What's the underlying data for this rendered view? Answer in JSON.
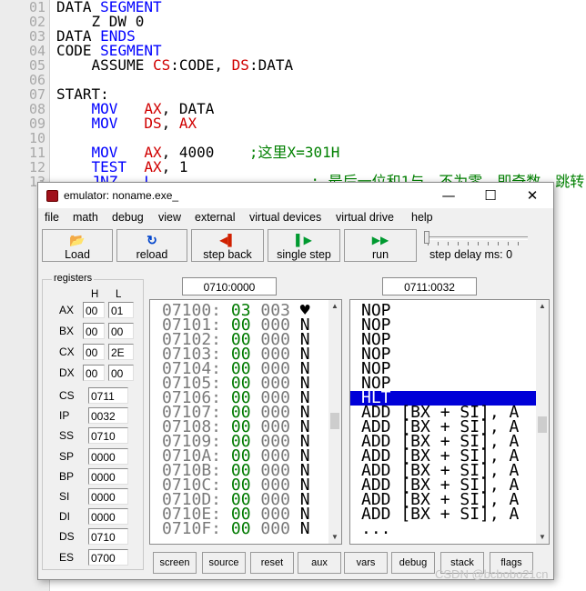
{
  "editor": {
    "line_numbers": [
      "01",
      "02",
      "03",
      "04",
      "05",
      "06",
      "07",
      "08",
      "09",
      "10",
      "11",
      "12",
      "13"
    ],
    "lines": [
      [
        {
          "t": "DATA ",
          "c": "txt"
        },
        {
          "t": "SEGMENT",
          "c": "kw"
        }
      ],
      [
        {
          "t": "    Z DW 0",
          "c": "txt"
        }
      ],
      [
        {
          "t": "DATA ",
          "c": "txt"
        },
        {
          "t": "ENDS",
          "c": "kw"
        }
      ],
      [
        {
          "t": "CODE ",
          "c": "txt"
        },
        {
          "t": "SEGMENT",
          "c": "kw"
        }
      ],
      [
        {
          "t": "    ASSUME ",
          "c": "txt"
        },
        {
          "t": "CS",
          "c": "rg"
        },
        {
          "t": ":CODE, ",
          "c": "txt"
        },
        {
          "t": "DS",
          "c": "rg"
        },
        {
          "t": ":DATA",
          "c": "txt"
        }
      ],
      [],
      [
        {
          "t": "START:",
          "c": "txt"
        }
      ],
      [
        {
          "t": "    MOV   ",
          "c": "kw"
        },
        {
          "t": "AX",
          "c": "rg"
        },
        {
          "t": ", DATA",
          "c": "txt"
        }
      ],
      [
        {
          "t": "    MOV   ",
          "c": "kw"
        },
        {
          "t": "DS",
          "c": "rg"
        },
        {
          "t": ", ",
          "c": "txt"
        },
        {
          "t": "AX",
          "c": "rg"
        }
      ],
      [],
      [
        {
          "t": "    MOV   ",
          "c": "kw"
        },
        {
          "t": "AX",
          "c": "rg"
        },
        {
          "t": ", 4000    ",
          "c": "txt"
        },
        {
          "t": ";这里X=301H",
          "c": "cm"
        }
      ],
      [
        {
          "t": "    TEST  ",
          "c": "kw"
        },
        {
          "t": "AX",
          "c": "rg"
        },
        {
          "t": ", 1",
          "c": "txt"
        }
      ],
      [
        {
          "t": "    JNZ   L                  ",
          "c": "kw"
        },
        {
          "t": "; 最后一位和1与，不为零，即奇数，跳转",
          "c": "cm"
        }
      ]
    ]
  },
  "window": {
    "title": "emulator: noname.exe_",
    "controls": {
      "minimize": "—",
      "maximize": "☐",
      "close": "✕"
    }
  },
  "menu": [
    "file",
    "math",
    "debug",
    "view",
    "external",
    "virtual devices",
    "virtual drive",
    "help"
  ],
  "toolbar": {
    "load": {
      "icon": "📂",
      "label": "Load"
    },
    "reload": {
      "icon": "↻",
      "label": "reload"
    },
    "step_back": {
      "icon": "◀▌",
      "label": "step back"
    },
    "single_step": {
      "icon": "▌▶",
      "label": "single step"
    },
    "run": {
      "icon": "▶▶",
      "label": "run"
    },
    "step_delay_label": "step delay ms: 0"
  },
  "registers": {
    "caption": "registers",
    "h_label": "H",
    "l_label": "L",
    "general": [
      {
        "name": "AX",
        "h": "00",
        "l": "01"
      },
      {
        "name": "BX",
        "h": "00",
        "l": "00"
      },
      {
        "name": "CX",
        "h": "00",
        "l": "2E"
      },
      {
        "name": "DX",
        "h": "00",
        "l": "00"
      }
    ],
    "special": [
      {
        "name": "CS",
        "value": "0711"
      },
      {
        "name": "IP",
        "value": "0032"
      },
      {
        "name": "SS",
        "value": "0710"
      },
      {
        "name": "SP",
        "value": "0000"
      },
      {
        "name": "BP",
        "value": "0000"
      },
      {
        "name": "SI",
        "value": "0000"
      },
      {
        "name": "DI",
        "value": "0000"
      },
      {
        "name": "DS",
        "value": "0710"
      },
      {
        "name": "ES",
        "value": "0700"
      }
    ]
  },
  "memory": {
    "address_field": "0710:0000",
    "rows": [
      {
        "addr": "07100:",
        "hex": "03",
        "dec": "003",
        "ch": "♥"
      },
      {
        "addr": "07101:",
        "hex": "00",
        "dec": "000",
        "ch": "N"
      },
      {
        "addr": "07102:",
        "hex": "00",
        "dec": "000",
        "ch": "N"
      },
      {
        "addr": "07103:",
        "hex": "00",
        "dec": "000",
        "ch": "N"
      },
      {
        "addr": "07104:",
        "hex": "00",
        "dec": "000",
        "ch": "N"
      },
      {
        "addr": "07105:",
        "hex": "00",
        "dec": "000",
        "ch": "N"
      },
      {
        "addr": "07106:",
        "hex": "00",
        "dec": "000",
        "ch": "N"
      },
      {
        "addr": "07107:",
        "hex": "00",
        "dec": "000",
        "ch": "N"
      },
      {
        "addr": "07108:",
        "hex": "00",
        "dec": "000",
        "ch": "N"
      },
      {
        "addr": "07109:",
        "hex": "00",
        "dec": "000",
        "ch": "N"
      },
      {
        "addr": "0710A:",
        "hex": "00",
        "dec": "000",
        "ch": "N"
      },
      {
        "addr": "0710B:",
        "hex": "00",
        "dec": "000",
        "ch": "N"
      },
      {
        "addr": "0710C:",
        "hex": "00",
        "dec": "000",
        "ch": "N"
      },
      {
        "addr": "0710D:",
        "hex": "00",
        "dec": "000",
        "ch": "N"
      },
      {
        "addr": "0710E:",
        "hex": "00",
        "dec": "000",
        "ch": "N"
      },
      {
        "addr": "0710F:",
        "hex": "00",
        "dec": "000",
        "ch": "N"
      }
    ]
  },
  "disassembly": {
    "address_field": "0711:0032",
    "rows": [
      "NOP",
      "NOP",
      "NOP",
      "NOP",
      "NOP",
      "NOP",
      "HLT",
      "ADD [BX + SI], A",
      "ADD [BX + SI], A",
      "ADD [BX + SI], A",
      "ADD [BX + SI], A",
      "ADD [BX + SI], A",
      "ADD [BX + SI], A",
      "ADD [BX + SI], A",
      "ADD [BX + SI], A",
      "..."
    ],
    "selected_index": 6
  },
  "bottom_buttons": [
    "screen",
    "source",
    "reset",
    "aux",
    "vars",
    "debug",
    "stack",
    "flags"
  ],
  "watermark": "CSDN @bcbobo21cn",
  "colors": {
    "selection": "#0000d8",
    "hex_green": "#007a00",
    "keyword": "#0000ff",
    "register": "#d00000",
    "comment": "#008000"
  }
}
